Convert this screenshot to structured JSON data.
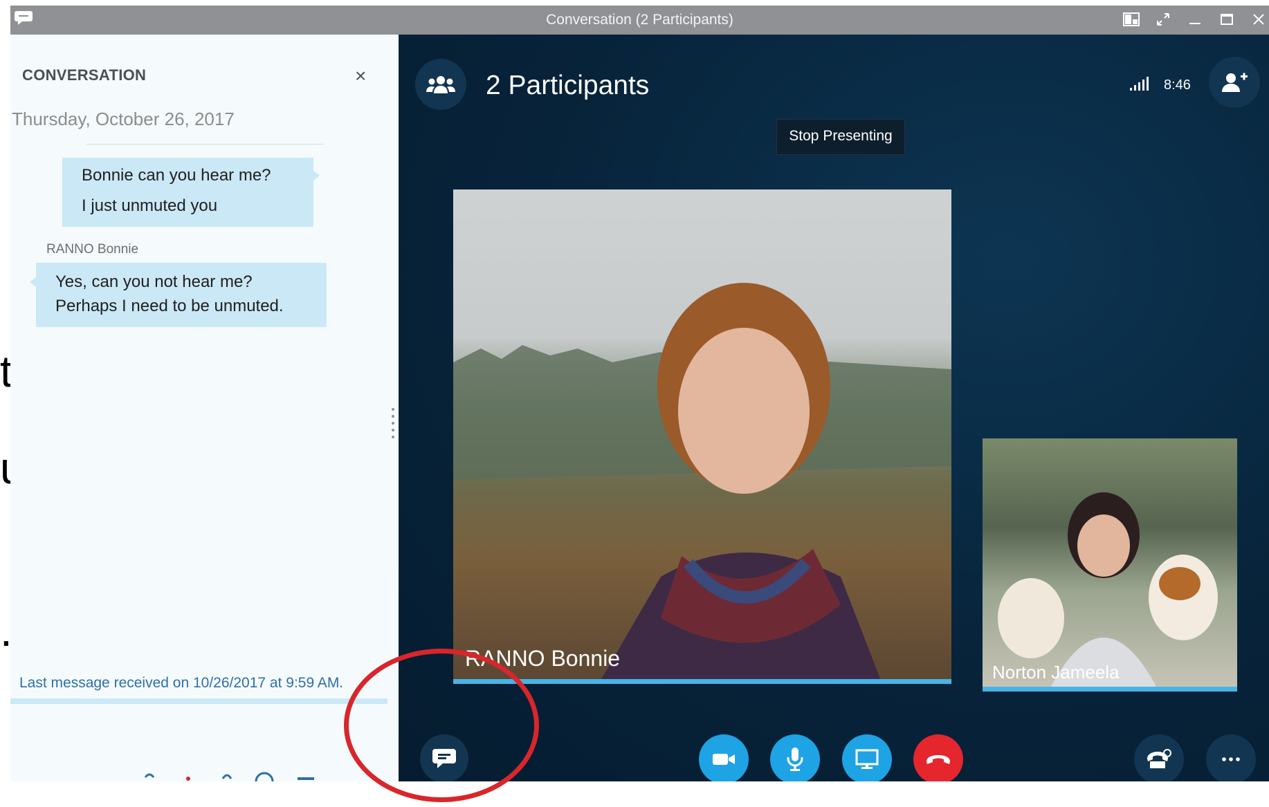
{
  "window": {
    "title": "Conversation (2 Participants)",
    "controls": [
      "layout-icon",
      "pop-out-icon",
      "minimize-icon",
      "maximize-icon",
      "close-icon"
    ]
  },
  "conversation": {
    "header": "CONVERSATION",
    "close_label": "×",
    "date": "Thursday, October 26, 2017",
    "messages": [
      {
        "sender": "",
        "lines": [
          "Bonnie can you hear me?",
          "I just unmuted you"
        ]
      },
      {
        "sender": "RANNO Bonnie",
        "lines": [
          "Yes, can you not hear me?",
          "Perhaps I need to be unmuted."
        ]
      }
    ],
    "last_message": "Last message received on 10/26/2017 at 9:59 AM."
  },
  "background_slide": {
    "fragments": [
      "th",
      "ur",
      "."
    ]
  },
  "meeting": {
    "title": "2 Participants",
    "time": "8:46",
    "stop_presenting": "Stop Presenting",
    "participants": [
      {
        "name": "RANNO Bonnie"
      },
      {
        "name": "Norton Jameela"
      }
    ]
  },
  "colors": {
    "accent_blue": "#1ea3e5",
    "hangup_red": "#e5262d",
    "annotation_red": "#d8262b",
    "video_bg": "#07233a",
    "bubble": "#cbe8f6"
  }
}
